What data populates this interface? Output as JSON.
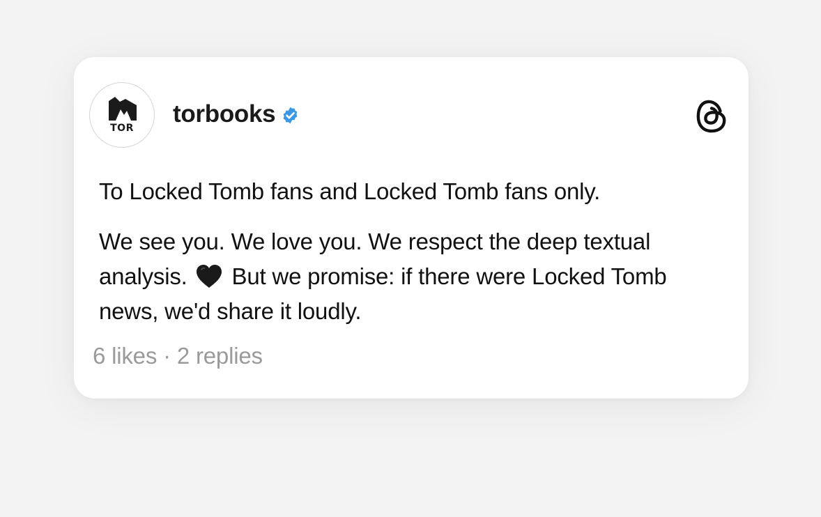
{
  "post": {
    "avatar_text": "TOR",
    "username": "torbooks",
    "verified": true,
    "line1": "To Locked Tomb fans and Locked Tomb fans only.",
    "para2_part1": "We see you. We love you. We respect the deep textual analysis.",
    "heart_emoji": "🖤",
    "para2_part2": "But we promise: if there were Locked Tomb news, we'd share it loudly.",
    "stats": "6 likes · 2 replies"
  },
  "icons": {
    "verified": "verified-badge-icon",
    "app": "threads-logo-icon",
    "heart": "black-heart-icon"
  },
  "colors": {
    "background": "#f3f3f3",
    "card": "#ffffff",
    "verified_blue": "#3b97e3",
    "text": "#111111",
    "muted": "#9a9a9a"
  }
}
